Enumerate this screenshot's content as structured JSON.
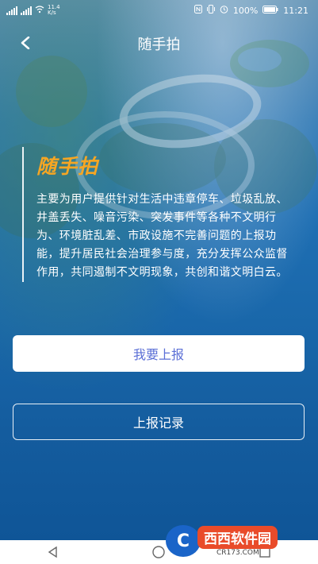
{
  "status_bar": {
    "net_speed_value": "11.4",
    "net_speed_unit": "K/s",
    "battery": "100%",
    "time": "11:21"
  },
  "nav": {
    "title": "随手拍"
  },
  "intro": {
    "title": "随手拍",
    "text": "主要为用户提供针对生活中违章停车、垃圾乱放、井盖丢失、噪音污染、突发事件等各种不文明行为、环境脏乱差、市政设施不完善问题的上报功能，提升居民社会治理参与度，充分发挥公众监督作用，共同遏制不文明现象，共创和谐文明白云。"
  },
  "buttons": {
    "report": "我要上报",
    "records": "上报记录"
  },
  "watermark": {
    "logo_letter": "C",
    "brand": "西西软件园",
    "site": "CR173.COM"
  },
  "colors": {
    "accent_title": "#f6a623",
    "button_text": "#5b6fd6",
    "background": "#1967aa"
  }
}
